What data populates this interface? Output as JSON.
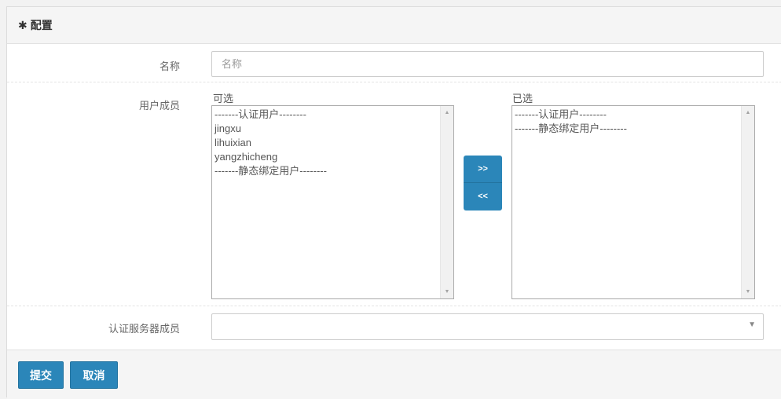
{
  "panel": {
    "title": "配置",
    "icon": "gear-icon"
  },
  "form": {
    "name": {
      "label": "名称",
      "placeholder": "名称",
      "value": ""
    },
    "members": {
      "label": "用户成员",
      "available": {
        "title": "可选",
        "items": [
          "-------认证用户--------",
          "jingxu",
          "lihuixian",
          "yangzhicheng",
          "-------静态绑定用户--------"
        ]
      },
      "selected": {
        "title": "已选",
        "items": [
          "-------认证用户--------",
          "-------静态绑定用户--------"
        ]
      },
      "add_label": ">>",
      "remove_label": "<<"
    },
    "auth_server": {
      "label": "认证服务器成员",
      "value": ""
    }
  },
  "footer": {
    "submit_label": "提交",
    "cancel_label": "取消"
  },
  "colors": {
    "primary": "#2b86b9",
    "header_bg": "#f5f5f5"
  }
}
